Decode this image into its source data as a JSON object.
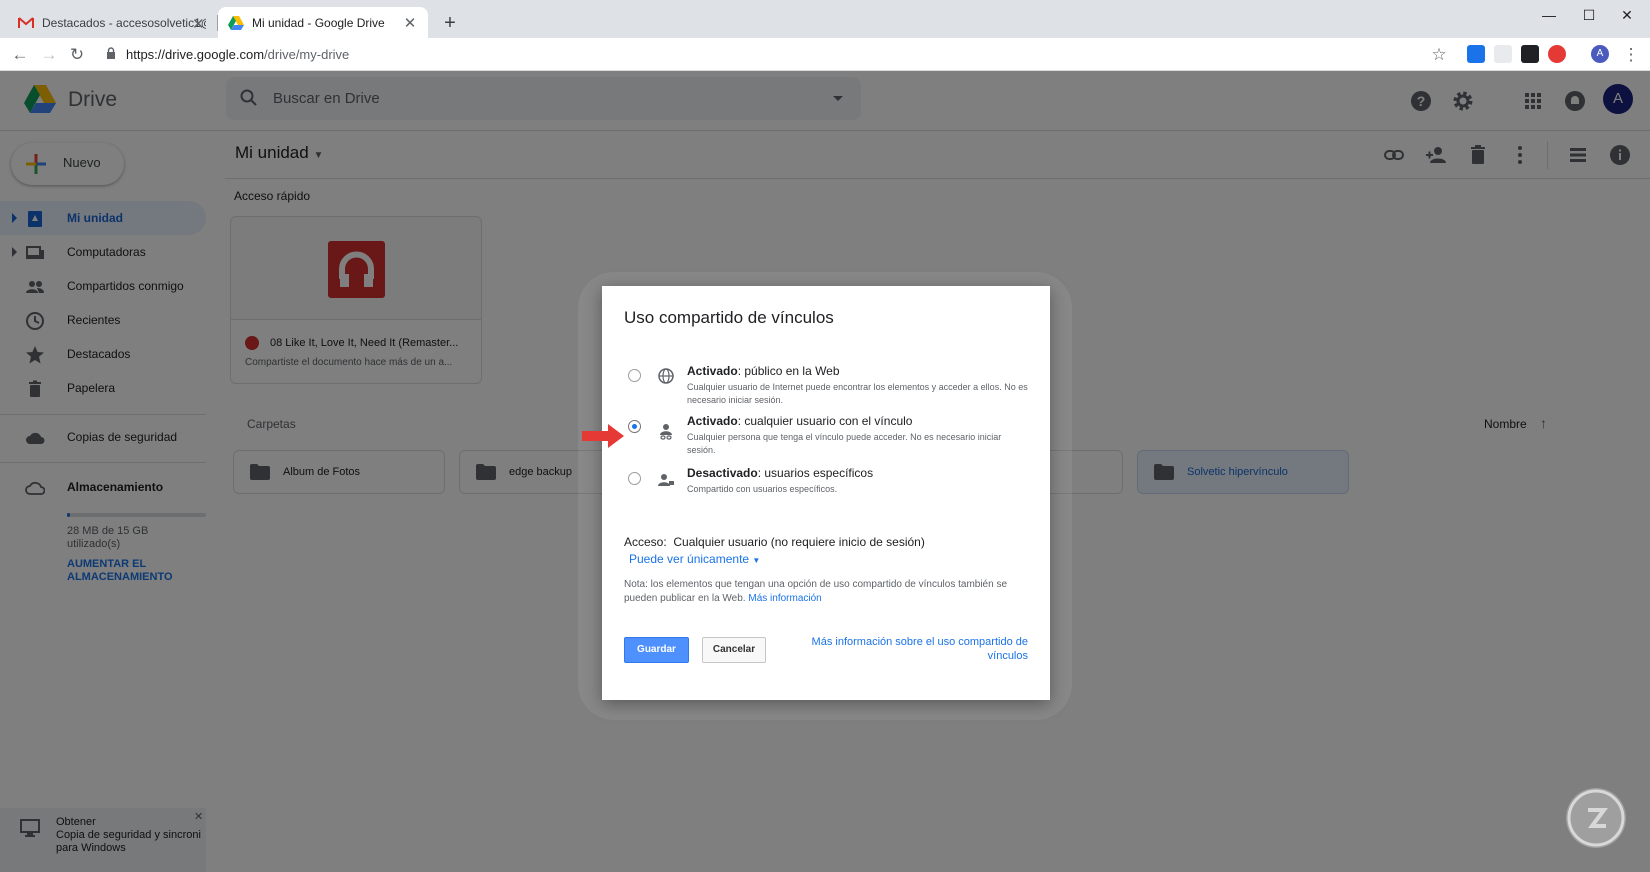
{
  "browser": {
    "tabs": [
      {
        "title": "Destacados - accesosolvetic1@g",
        "icon": "gmail-icon",
        "active": false
      },
      {
        "title": "Mi unidad - Google Drive",
        "icon": "drive-icon",
        "active": true
      }
    ],
    "url_host": "https://drive.google.com",
    "url_path": "/drive/my-drive",
    "profile_initial": "A"
  },
  "drive": {
    "logo_text": "Drive",
    "search_placeholder": "Buscar en Drive",
    "account_initial": "A",
    "location_title": "Mi unidad",
    "new_button": "Nuevo",
    "nav": [
      {
        "label": "Mi unidad",
        "icon": "my-drive-icon",
        "selected": true
      },
      {
        "label": "Computadoras",
        "icon": "computers-icon",
        "selected": false
      },
      {
        "label": "Compartidos conmigo",
        "icon": "shared-icon",
        "selected": false
      },
      {
        "label": "Recientes",
        "icon": "clock-icon",
        "selected": false
      },
      {
        "label": "Destacados",
        "icon": "star-icon",
        "selected": false
      },
      {
        "label": "Papelera",
        "icon": "trash-icon",
        "selected": false
      }
    ],
    "backup_label": "Copias de seguridad",
    "storage": {
      "label": "Almacenamiento",
      "usage": "28 MB de 15 GB",
      "usage_line2": "utilizado(s)",
      "upgrade_line1": "AUMENTAR EL",
      "upgrade_line2": "ALMACENAMIENTO",
      "used_fraction": 0.002
    },
    "quick_access": {
      "label": "Acceso rápido",
      "file_title": "08 Like It, Love It, Need It (Remaster...",
      "file_sub": "Compartiste el documento hace más de un a..."
    },
    "folders_label": "Carpetas",
    "sort_label": "Nombre",
    "folders": [
      {
        "name": "Album de Fotos",
        "selected": false
      },
      {
        "name": "edge backup",
        "selected": false
      },
      {
        "name": "Solvetic hipervínculo",
        "selected": true
      }
    ],
    "promo": {
      "line1": "Obtener",
      "line2": "Copia de seguridad y sincroni",
      "line3": "para Windows"
    }
  },
  "dialog": {
    "title": "Uso compartido de vínculos",
    "options": [
      {
        "status": "Activado",
        "title": ": público en la Web",
        "desc": "Cualquier usuario de Internet puede encontrar los elementos y acceder a ellos. No es necesario iniciar sesión.",
        "checked": false,
        "icon": "globe-icon"
      },
      {
        "status": "Activado",
        "title": ": cualquier usuario con el vínculo",
        "desc": "Cualquier persona que tenga el vínculo puede acceder. No es necesario iniciar sesión.",
        "checked": true,
        "icon": "link-person-icon"
      },
      {
        "status": "Desactivado",
        "title": ": usuarios específicos",
        "desc": "Compartido con usuarios específicos.",
        "checked": false,
        "icon": "person-lock-icon"
      }
    ],
    "access_label": "Acceso:",
    "access_value": "Cualquier usuario (no requiere inicio de sesión)",
    "permission": "Puede ver únicamente",
    "note": "Nota: los elementos que tengan una opción de uso compartido de vínculos también se pueden publicar en la Web.",
    "note_link": "Más información",
    "save": "Guardar",
    "cancel": "Cancelar",
    "more_link": "Más información sobre el uso compartido de vínculos"
  },
  "colors": {
    "accent": "#1a73e8",
    "annotation_arrow": "#e53935",
    "overlay": "rgba(0,0,0,0.5)"
  }
}
